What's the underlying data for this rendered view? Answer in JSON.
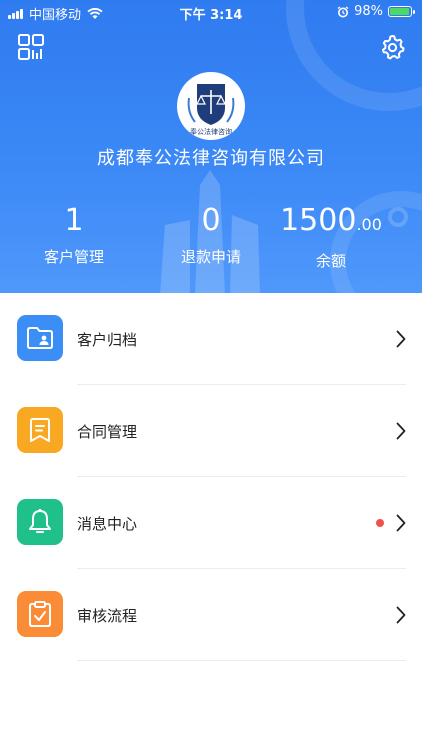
{
  "status_bar": {
    "carrier": "中国移动",
    "time": "下午 3:14",
    "battery_percent": "98%",
    "battery_level": 0.98
  },
  "company": {
    "name": "成都奉公法律咨询有限公司",
    "logo_text": "奉公法律咨询"
  },
  "stats": [
    {
      "value": "1",
      "label": "客户管理"
    },
    {
      "value": "0",
      "label": "退款申请"
    },
    {
      "value": "1500",
      "decimals": ".00",
      "label": "余额"
    }
  ],
  "menu": [
    {
      "label": "客户归档",
      "icon": "folder-user-icon",
      "color": "#3a8ef6",
      "unread": false
    },
    {
      "label": "合同管理",
      "icon": "bookmark-doc-icon",
      "color": "#f9a821",
      "unread": false
    },
    {
      "label": "消息中心",
      "icon": "bell-icon",
      "color": "#20c08a",
      "unread": true
    },
    {
      "label": "审核流程",
      "icon": "clipboard-check-icon",
      "color": "#fa8b37",
      "unread": false
    }
  ],
  "colors": {
    "header_blue": "#2f7bf0",
    "unread_dot": "#f0514d"
  }
}
